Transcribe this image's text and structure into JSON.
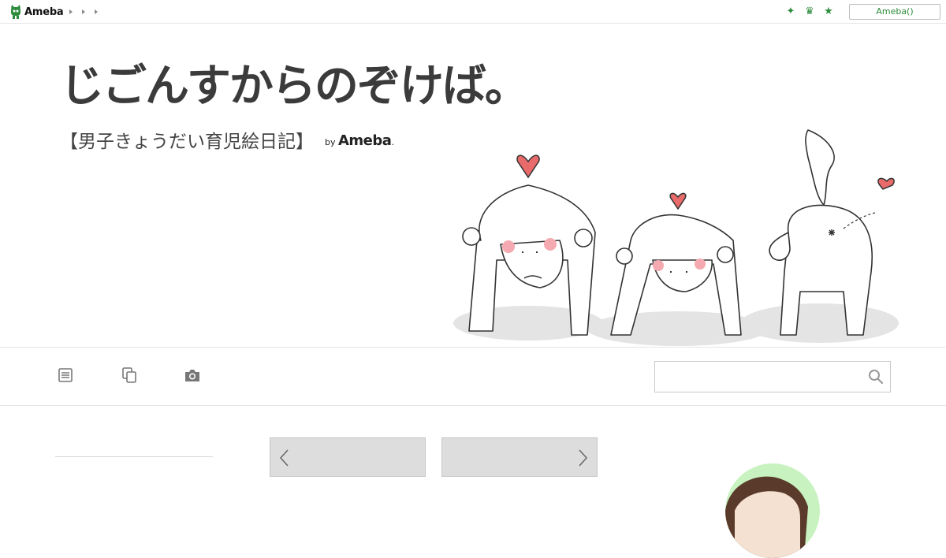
{
  "topbar": {
    "logo_text": "Ameba",
    "login_label": "Ameba()",
    "accent_color": "#2d8c3c",
    "icons": [
      "sparkle-icon",
      "crown-icon",
      "star-icon"
    ]
  },
  "header": {
    "title": "じごんすからのぞけば。",
    "subtitle": "【男子きょうだい育児絵日記】",
    "by_prefix": "by",
    "by_brand": "Ameba",
    "by_suffix": "."
  },
  "nav": {
    "icons": [
      "entry-list-icon",
      "themes-icon",
      "camera-icon"
    ]
  },
  "search": {
    "value": "",
    "placeholder": ""
  }
}
